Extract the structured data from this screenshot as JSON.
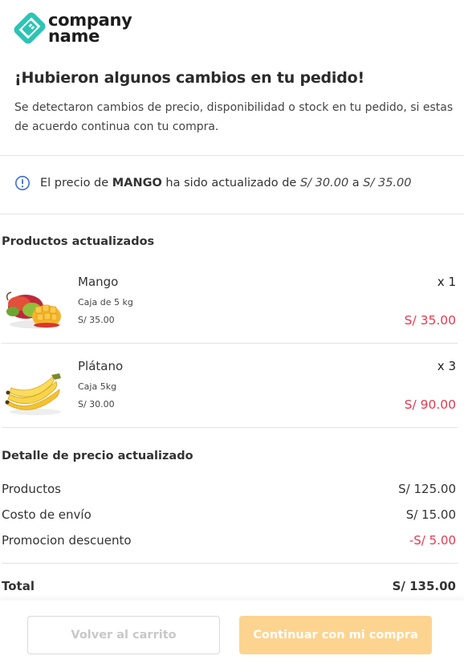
{
  "brand": {
    "line1": "company",
    "line2": "name",
    "accent": "#2bc4b4"
  },
  "header": {
    "title": "¡Hubieron algunos cambios en tu pedido!",
    "subtitle": "Se detectaron cambios de precio, disponibilidad o stock en tu pedido, si estas de acuerdo continua con tu compra."
  },
  "notice": {
    "icon": "info-circle-icon",
    "prefix": "El precio de ",
    "product": "MANGO",
    "middle": " ha sido actualizado de ",
    "old_price": "S/ 30.00",
    "connector": " a ",
    "new_price": "S/ 35.00"
  },
  "products_section": {
    "title": "Productos actualizados",
    "items": [
      {
        "name": "Mango",
        "description": "Caja de 5 kg",
        "unit_price": "S/ 35.00",
        "quantity": "x 1",
        "total": "S/ 35.00",
        "image": "mango-image"
      },
      {
        "name": "Plátano",
        "description": "Caja 5kg",
        "unit_price": "S/ 30.00",
        "quantity": "x 3",
        "total": "S/ 90.00",
        "image": "banana-image"
      }
    ]
  },
  "price_detail": {
    "title": "Detalle de precio actualizado",
    "rows": [
      {
        "label": "Productos",
        "value": "S/ 125.00"
      },
      {
        "label": "Costo de envío",
        "value": "S/ 15.00"
      },
      {
        "label": "Promocion descuento",
        "value": "-S/ 5.00"
      }
    ],
    "total": {
      "label": "Total",
      "value": "S/ 135.00"
    }
  },
  "actions": {
    "back_label": "Volver al carrito",
    "continue_label": "Continuar con mi compra"
  },
  "colors": {
    "price_red": "#e53950",
    "primary_button": "#fcd490",
    "info_blue": "#3d6fd8"
  }
}
